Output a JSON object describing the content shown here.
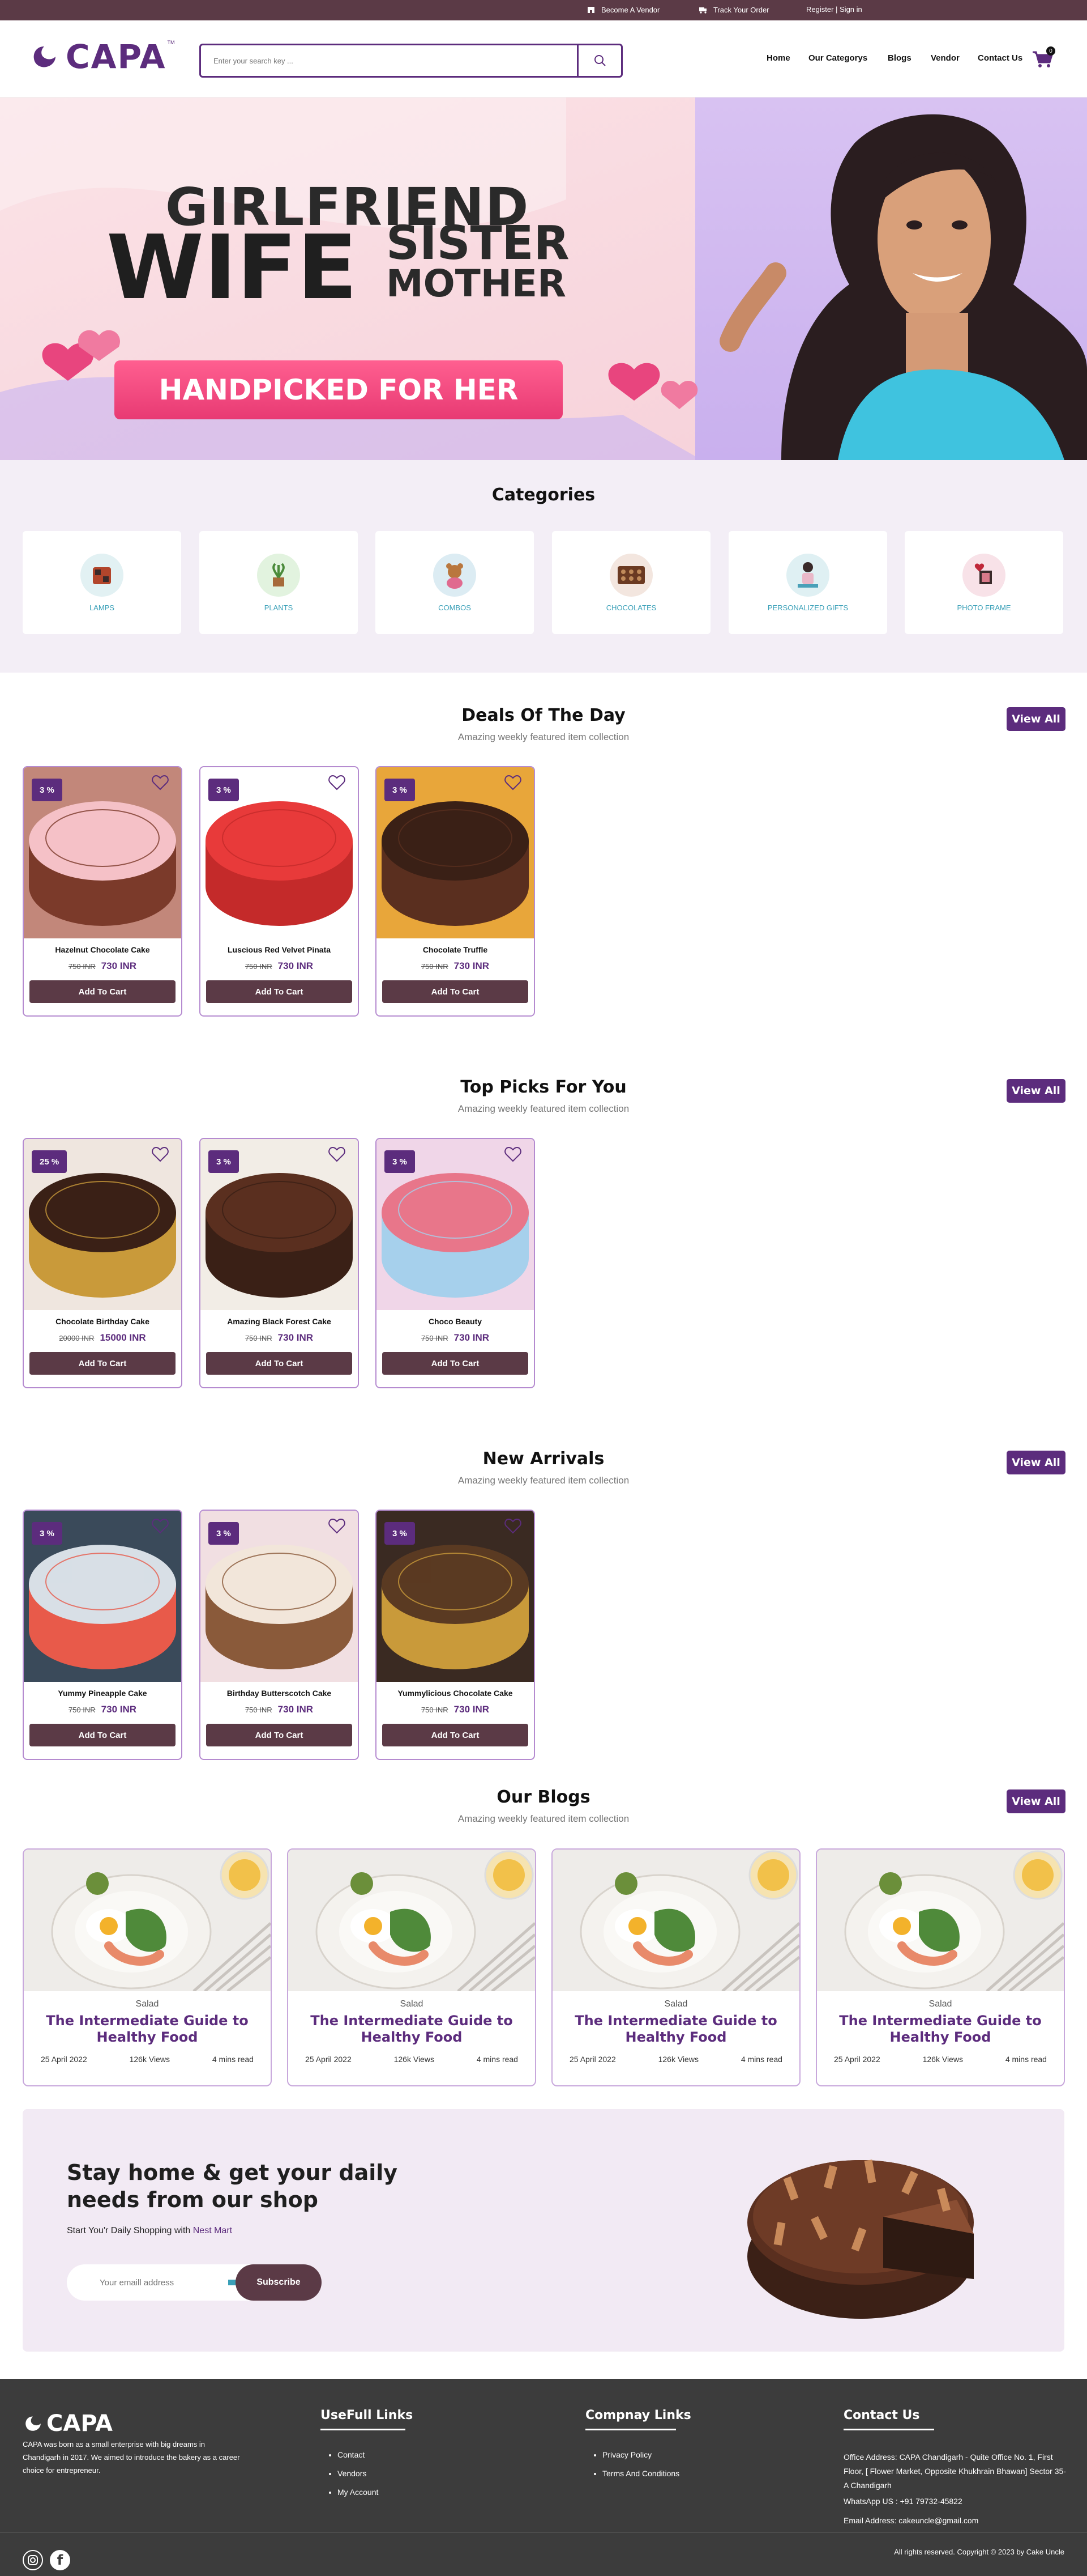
{
  "topbar": {
    "become_vendor": "Become A Vendor",
    "track_order": "Track Your Order",
    "register": "Register | Sign in"
  },
  "header": {
    "logo_text": "CAPA",
    "logo_tm": "TM",
    "search_placeholder": "Enter your search key ...",
    "nav": [
      "Home",
      "Our Categorys",
      "Blogs",
      "Vendor",
      "Contact Us"
    ],
    "cart_count": "0"
  },
  "banner": {
    "line1": "GIRLFRIEND",
    "line2": "WIFE",
    "line3": "SISTER",
    "line4": "MOTHER",
    "cta": "HANDPICKED FOR HER"
  },
  "categories": {
    "title": "Categories",
    "items": [
      {
        "label": "LAMPS",
        "icon": "lamp-icon",
        "bg": "#e2f1f3"
      },
      {
        "label": "PLANTS",
        "icon": "plant-icon",
        "bg": "#e2f3df"
      },
      {
        "label": "COMBOS",
        "icon": "teddy-icon",
        "bg": "#dcecf3"
      },
      {
        "label": "CHOCOLATES",
        "icon": "chocolate-box-icon",
        "bg": "#f3e6df"
      },
      {
        "label": "PERSONALIZED GIFTS",
        "icon": "figurine-icon",
        "bg": "#dff0f3"
      },
      {
        "label": "Photo Frame",
        "icon": "photo-frame-icon",
        "bg": "#f8e2e8"
      }
    ]
  },
  "sections": [
    {
      "title": "Deals Of The Day",
      "subtitle": "Amazing weekly featured item collection",
      "view_all": "View All",
      "products": [
        {
          "name": "Hazelnut Chocolate Cake",
          "discount": "3 %",
          "old_price": "750 INR",
          "price": "730 INR",
          "cta": "Add To Cart"
        },
        {
          "name": "Luscious Red Velvet Pinata",
          "discount": "3 %",
          "old_price": "750 INR",
          "price": "730 INR",
          "cta": "Add To Cart"
        },
        {
          "name": "Chocolate Truffle",
          "discount": "3 %",
          "old_price": "750 INR",
          "price": "730 INR",
          "cta": "Add To Cart"
        }
      ]
    },
    {
      "title": "Top Picks For You",
      "subtitle": "Amazing weekly featured item collection",
      "view_all": "View All",
      "products": [
        {
          "name": "Chocolate Birthday Cake",
          "discount": "25 %",
          "old_price": "20000 INR",
          "price": "15000 INR",
          "cta": "Add To Cart"
        },
        {
          "name": "Amazing Black Forest Cake",
          "discount": "3 %",
          "old_price": "750 INR",
          "price": "730 INR",
          "cta": "Add To Cart"
        },
        {
          "name": "Choco Beauty",
          "discount": "3 %",
          "old_price": "750 INR",
          "price": "730 INR",
          "cta": "Add To Cart"
        }
      ]
    },
    {
      "title": "New Arrivals",
      "subtitle": "Amazing weekly featured item collection",
      "view_all": "View All",
      "products": [
        {
          "name": "Yummy Pineapple Cake",
          "discount": "3 %",
          "old_price": "750 INR",
          "price": "730 INR",
          "cta": "Add To Cart"
        },
        {
          "name": "Birthday Butterscotch Cake",
          "discount": "3 %",
          "old_price": "750 INR",
          "price": "730 INR",
          "cta": "Add To Cart"
        },
        {
          "name": "Yummylicious Chocolate Cake",
          "discount": "3 %",
          "old_price": "750 INR",
          "price": "730 INR",
          "cta": "Add To Cart"
        }
      ]
    }
  ],
  "blogs": {
    "title": "Our Blogs",
    "subtitle": "Amazing weekly featured item collection",
    "view_all": "View All",
    "items": [
      {
        "category": "Salad",
        "title": "The Intermediate Guide to Healthy Food",
        "date": "25 April 2022",
        "views": "126k Views",
        "read": "4 mins read"
      },
      {
        "category": "Salad",
        "title": "The Intermediate Guide to Healthy Food",
        "date": "25 April 2022",
        "views": "126k Views",
        "read": "4 mins read"
      },
      {
        "category": "Salad",
        "title": "The Intermediate Guide to Healthy Food",
        "date": "25 April 2022",
        "views": "126k Views",
        "read": "4 mins read"
      },
      {
        "category": "Salad",
        "title": "The Intermediate Guide to Healthy Food",
        "date": "25 April 2022",
        "views": "126k Views",
        "read": "4 mins read"
      }
    ]
  },
  "subscribe": {
    "heading_line1": "Stay home & get your daily",
    "heading_line2": "needs from our shop",
    "sub_prefix": "Start You'r Daily Shopping with ",
    "sub_brand": "Nest Mart",
    "email_placeholder": "Your emaill address",
    "button": "Subscribe"
  },
  "footer": {
    "logo_text": "CAPA",
    "about": "CAPA was born as a small enterprise with big dreams in Chandigarh in 2017. We aimed to introduce the bakery as a career choice for entrepreneur.",
    "useful_title": "UseFull Links",
    "useful_links": [
      "Contact",
      "Vendors",
      "My Account"
    ],
    "company_title": "Compnay Links",
    "company_links": [
      "Privacy Policy",
      "Terms And Conditions"
    ],
    "contact_title": "Contact Us",
    "address": "Office Address: CAPA Chandigarh - Quite Office No. 1, First Floor, [ Flower Market, Opposite Khukhrain Bhawan] Sector 35-A Chandigarh",
    "whatsapp": "WhatsApp US : +91 79732-45822",
    "email": "Email Address: cakeuncle@gmail.com",
    "copyright": "All rights reserved. Copyright © 2023 by Cake Uncle"
  },
  "colors": {
    "brand": "#5c2c7d",
    "topbar": "#5b3a46",
    "footer": "#3c3c3c",
    "cart_button": "#5b3a46"
  }
}
